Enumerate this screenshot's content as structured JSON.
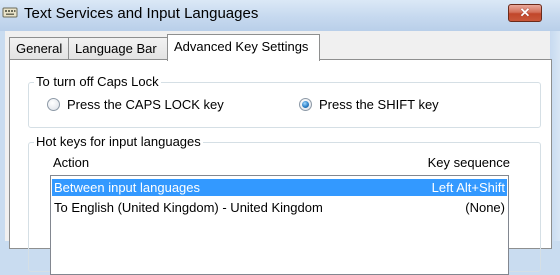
{
  "window": {
    "title": "Text Services and Input Languages",
    "close_glyph": "✕"
  },
  "tabs": [
    {
      "label": "General",
      "active": false
    },
    {
      "label": "Language Bar",
      "active": false
    },
    {
      "label": "Advanced Key Settings",
      "active": true
    }
  ],
  "caps_lock_group": {
    "title": "To turn off Caps Lock",
    "options": [
      {
        "label": "Press the CAPS LOCK key",
        "checked": false
      },
      {
        "label": "Press the SHIFT key",
        "checked": true
      }
    ]
  },
  "hotkeys_group": {
    "title": "Hot keys for input languages",
    "columns": {
      "action": "Action",
      "key_sequence": "Key sequence"
    },
    "rows": [
      {
        "action": "Between input languages",
        "key_sequence": "Left Alt+Shift",
        "selected": true
      },
      {
        "action": "To English (United Kingdom) - United Kingdom",
        "key_sequence": "(None)",
        "selected": false
      }
    ]
  },
  "colors": {
    "selection": "#3399ff",
    "close_button": "#c1472b",
    "title_bar": "#c6d9ef"
  }
}
